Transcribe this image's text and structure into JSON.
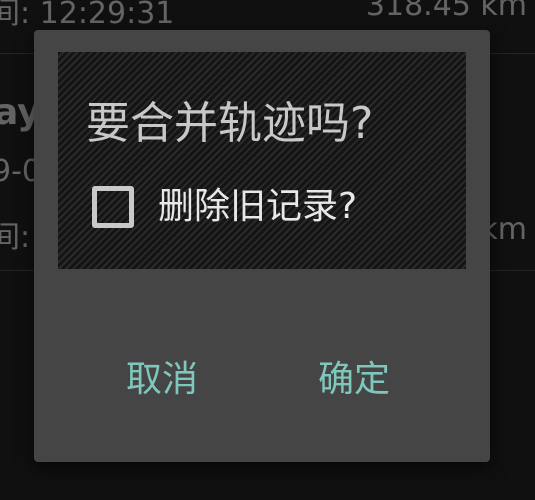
{
  "background": {
    "rows": [
      {
        "left": "间: 12:29:31",
        "right": "318.45 km"
      },
      {
        "left": "ay",
        "right": ""
      },
      {
        "left": "9-0",
        "right": ""
      },
      {
        "left": "间:",
        "right": "km"
      }
    ]
  },
  "dialog": {
    "title": "要合并轨迹吗?",
    "checkbox": {
      "label": "删除旧记录?",
      "checked": false
    },
    "buttons": {
      "cancel": "取消",
      "confirm": "确定"
    }
  },
  "colors": {
    "dialog_bg": "#454545",
    "accent": "#7fc7bd",
    "title_text": "#c8c8c8"
  }
}
